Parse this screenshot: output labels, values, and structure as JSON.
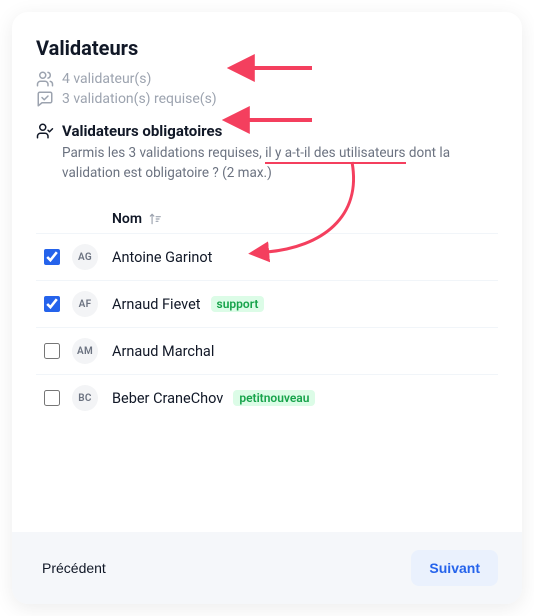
{
  "title": "Validateurs",
  "meta": {
    "validators_count": "4 validateur(s)",
    "required_count": "3 validation(s) requise(s)"
  },
  "section": {
    "heading": "Validateurs obligatoires",
    "desc_pre": "Parmis les 3 validations requises, ",
    "desc_highlight": "il y a-t-il des utilisateurs",
    "desc_post": " dont la validation est obligatoire ? (2 max.)"
  },
  "table": {
    "head_name": "Nom",
    "rows": [
      {
        "checked": true,
        "initials": "AG",
        "name": "Antoine Garinot",
        "tag": ""
      },
      {
        "checked": true,
        "initials": "AF",
        "name": "Arnaud Fievet",
        "tag": "support"
      },
      {
        "checked": false,
        "initials": "AM",
        "name": "Arnaud Marchal",
        "tag": ""
      },
      {
        "checked": false,
        "initials": "BC",
        "name": "Beber CraneChov",
        "tag": "petitnouveau"
      }
    ]
  },
  "footer": {
    "prev": "Précédent",
    "next": "Suivant"
  },
  "annotation": {
    "color": "#f43f5e"
  }
}
